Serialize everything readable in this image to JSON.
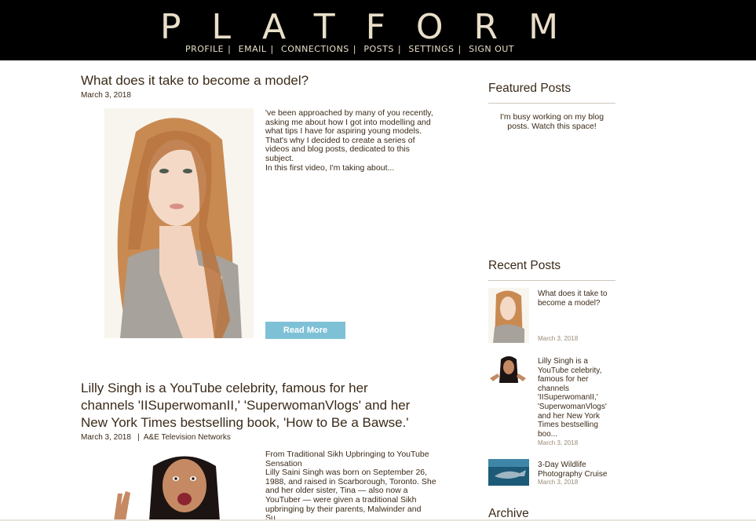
{
  "header": {
    "brand": "PLATFORM",
    "nav": [
      "Profile",
      "Email",
      "Connections",
      "Posts",
      "Settings",
      "Sign Out"
    ]
  },
  "posts": [
    {
      "title": "What does it take to become a model?",
      "date": "March 3, 2018",
      "excerpt_lines": [
        "'ve been approached by many of you recently,",
        "asking me about how I got into modelling and",
        "what tips I have for aspiring young models.",
        "That's why I decided to create a series of",
        "videos and blog posts, dedicated to this",
        "subject.",
        "In this first video, I'm taking about..."
      ],
      "read_more": "Read More"
    },
    {
      "title_lines": [
        "Lilly Singh is a YouTube celebrity, famous for her",
        "channels 'IISuperwomanII,' 'SuperwomanVlogs' and her",
        "New York Times bestselling book, 'How to Be a Bawse.'"
      ],
      "date": "March 3, 2018",
      "source": "A&E Television Networks",
      "excerpt_lines": [
        "From Traditional Sikh Upbringing to YouTube",
        "Sensation",
        "Lilly Saini Singh was born on September 26,",
        "1988, and raised in Scarborough, Toronto. She",
        "and her older sister, Tina — also now a",
        "YouTuber — were given a traditional Sikh",
        "upbringing by their parents, Malwinder and",
        "Su..."
      ]
    }
  ],
  "sidebar": {
    "featured_heading": "Featured Posts",
    "featured_text": "I'm busy working on my blog posts. Watch this space!",
    "recent_heading": "Recent Posts",
    "recent": [
      {
        "title": "What does it take to become a model?",
        "date": "March 3, 2018"
      },
      {
        "title": "Lilly Singh is a YouTube celebrity, famous for her channels 'IISuperwomanII,' 'SuperwomanVlogs' and her New York Times bestselling boo...",
        "date": "March 3, 2018"
      },
      {
        "title": "3-Day Wildlife Photography Cruise",
        "date": "March 3, 2018"
      }
    ],
    "archive_heading": "Archive"
  },
  "colors": {
    "header_bg": "#000000",
    "brand": "#e9dfc9",
    "button": "#7ec1d6",
    "text": "#3b2a19"
  }
}
